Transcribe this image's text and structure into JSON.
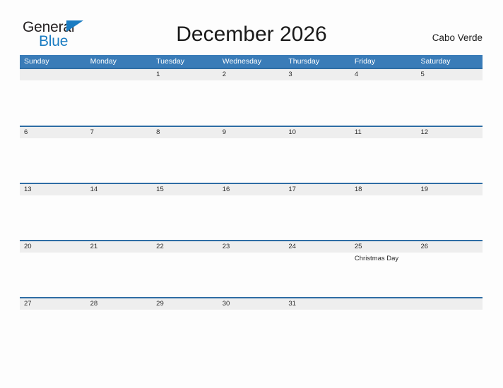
{
  "brand": {
    "name_part1": "General",
    "name_part2": "Blue",
    "accent_color": "#1a7cc2",
    "flag_icon": "flag-triangle-icon"
  },
  "header": {
    "title": "December 2026",
    "location": "Cabo Verde"
  },
  "calendar": {
    "header_bg": "#3a7cb8",
    "row_band_bg": "#eeeeee",
    "row_border_color": "#2e6da4",
    "weekdays": [
      "Sunday",
      "Monday",
      "Tuesday",
      "Wednesday",
      "Thursday",
      "Friday",
      "Saturday"
    ],
    "weeks": [
      {
        "dates": [
          "",
          "",
          "1",
          "2",
          "3",
          "4",
          "5"
        ],
        "events": [
          "",
          "",
          "",
          "",
          "",
          "",
          ""
        ]
      },
      {
        "dates": [
          "6",
          "7",
          "8",
          "9",
          "10",
          "11",
          "12"
        ],
        "events": [
          "",
          "",
          "",
          "",
          "",
          "",
          ""
        ]
      },
      {
        "dates": [
          "13",
          "14",
          "15",
          "16",
          "17",
          "18",
          "19"
        ],
        "events": [
          "",
          "",
          "",
          "",
          "",
          "",
          ""
        ]
      },
      {
        "dates": [
          "20",
          "21",
          "22",
          "23",
          "24",
          "25",
          "26"
        ],
        "events": [
          "",
          "",
          "",
          "",
          "",
          "Christmas Day",
          ""
        ]
      },
      {
        "dates": [
          "27",
          "28",
          "29",
          "30",
          "31",
          "",
          ""
        ],
        "events": [
          "",
          "",
          "",
          "",
          "",
          "",
          ""
        ]
      }
    ]
  }
}
